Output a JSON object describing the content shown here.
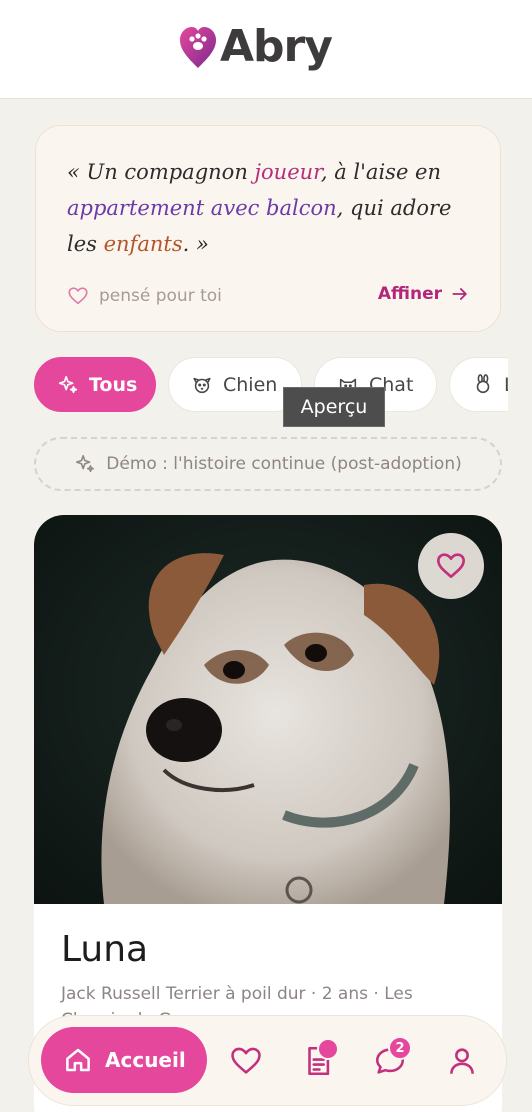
{
  "header": {
    "brand": "Abry",
    "logo_icon": "heart-paw-logo"
  },
  "quote": {
    "open": "« Un compagnon ",
    "hl1": "joueur",
    "mid1": ", à l'aise en ",
    "hl2": "appartement avec balcon",
    "mid2": ", qui adore les ",
    "hl3": "enfants",
    "close": ". »",
    "for_you_label": "pensé pour toi",
    "refine_label": "Affiner"
  },
  "filters": {
    "chips": [
      {
        "label": "Tous",
        "icon": "sparkles-icon",
        "active": true
      },
      {
        "label": "Chien",
        "icon": "dog-icon",
        "active": false
      },
      {
        "label": "Chat",
        "icon": "cat-icon",
        "active": false
      },
      {
        "label": "L",
        "icon": "rabbit-icon",
        "active": false
      }
    ]
  },
  "tooltip": {
    "text": "Aperçu"
  },
  "demo": {
    "label": "Démo : l'histoire continue (post-adoption)"
  },
  "pet": {
    "name": "Luna",
    "meta": "Jack Russell Terrier à poil dur · 2 ans · Les Chemin de Gr..."
  },
  "nav": {
    "home_label": "Accueil",
    "messages_badge": "2"
  },
  "colors": {
    "accent": "#e5479c",
    "highlight_joueur": "#b22f79",
    "highlight_appartement": "#6b3aa8",
    "highlight_enfants": "#b5532a",
    "background": "#f3f1ec"
  }
}
